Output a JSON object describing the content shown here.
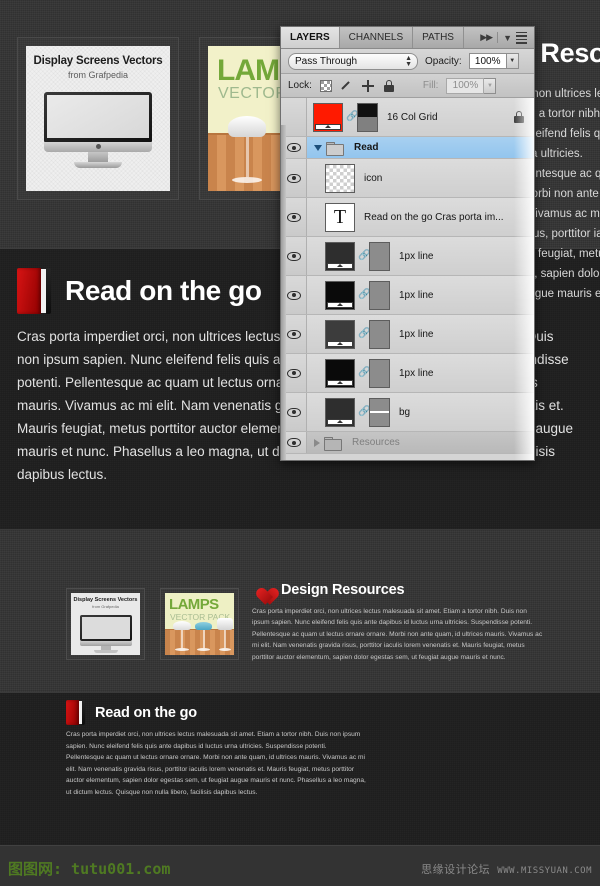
{
  "hero": {
    "thumb_display": {
      "title": "Display Screens Vectors",
      "subtitle": "from Grafpedia"
    },
    "thumb_lamps": {
      "line1": "LAMPS",
      "line2": "VECTOR PACK"
    },
    "resources_title": "Design Resources",
    "resources_body": "Cras porta imperdiet orci, non ultrices lectus malesuada sit amet. Etiam a tortor nibh. Duis non ipsum sapien. Nunc eleifend felis quis ante dapibus id luctus urna ultricies. Suspendisse potenti. Pellentesque ac quam ut lectus ornare ornare. Morbi non ante quam, id ultrices mauris. Vivamus ac mi elit. Nam venenatis gravida risus, porttitor iaculis lorem venenatis et. Mauris feugiat, metus porttitor auctor elementum, sapien dolor egestas sem, ut feugiat augue mauris et nunc."
  },
  "read_section": {
    "title": "Read on the go",
    "body": "Cras porta imperdiet orci, non ultrices lectus malesuada sit amet. Etiam a tortor nibh. Duis non ipsum sapien. Nunc eleifend felis quis ante dapibus id luctus urna ultricies. Suspendisse potenti. Pellentesque ac quam ut lectus ornare ornare. Morbi non ante quam, id ultrices mauris. Vivamus ac mi elit. Nam venenatis gravida risus, porttitor iaculis lorem venenatis et. Mauris feugiat, metus porttitor auctor elementum, sapien dolor egestas sem, ut feugiat augue mauris et nunc. Phasellus a leo magna, ut dictum lectus. Quisque non nulla libero, facilisis dapibus lectus."
  },
  "resources_section": {
    "title": "Design Resources",
    "body": "Cras porta imperdiet orci, non ultrices lectus malesuada sit amet. Etiam a tortor nibh. Duis non ipsum sapien. Nunc eleifend felis quis ante dapibus id luctus urna ultricies. Suspendisse potenti. Pellentesque ac quam ut lectus ornare ornare. Morbi non ante quam, id ultrices mauris. Vivamus ac mi elit. Nam venenatis gravida risus, porttitor iaculis lorem venenatis et. Mauris feugiat, metus porttitor auctor elementum, sapien dolor egestas sem, ut feugiat augue mauris et nunc.",
    "thumb_display": {
      "title": "Display Screens Vectors",
      "subtitle": "from Grafpedia"
    },
    "thumb_lamps": {
      "line1": "LAMPS",
      "line2": "VECTOR PACK"
    }
  },
  "read_section2": {
    "title": "Read on the go",
    "body": "Cras porta imperdiet orci, non ultrices lectus malesuada sit amet. Etiam a tortor nibh. Duis non ipsum sapien. Nunc eleifend felis quis ante dapibus id luctus urna ultricies. Suspendisse potenti. Pellentesque ac quam ut lectus ornare ornare. Morbi non ante quam, id ultrices mauris. Vivamus ac mi elit. Nam venenatis gravida risus, porttitor iaculis lorem venenatis et. Mauris feugiat, metus porttitor auctor elementum, sapien dolor egestas sem, ut feugiat augue mauris et nunc. Phasellus a leo magna, ut dictum lectus. Quisque non nulla libero, facilisis dapibus lectus."
  },
  "footer": {
    "watermark_left": "图图网: tutu001.com",
    "watermark_right_cn": "思缘设计论坛",
    "watermark_right_url": "WWW.MISSYUAN.COM"
  },
  "photoshop_panel": {
    "tabs": [
      {
        "label": "LAYERS",
        "active": true
      },
      {
        "label": "CHANNELS",
        "active": false
      },
      {
        "label": "PATHS",
        "active": false
      }
    ],
    "blend_mode": "Pass Through",
    "opacity_label": "Opacity:",
    "opacity_value": "100%",
    "lock_label": "Lock:",
    "fill_label": "Fill:",
    "fill_value": "100%",
    "lock_icons": [
      "transparency-checker-icon",
      "brush-icon",
      "move-icon",
      "lock-all-icon"
    ],
    "layers": [
      {
        "name": "16 Col Grid",
        "kind": "shape-mask",
        "visible": false,
        "locked": true,
        "selected": false,
        "thumb": "red"
      },
      {
        "name": "Read",
        "kind": "group",
        "visible": true,
        "locked": false,
        "selected": true,
        "expanded": true
      },
      {
        "name": "icon",
        "kind": "pixel",
        "visible": true,
        "locked": false,
        "selected": false,
        "thumb": "checker"
      },
      {
        "name": "Read on the go  Cras porta im...",
        "kind": "text",
        "visible": true,
        "locked": false,
        "selected": false,
        "thumb": "T"
      },
      {
        "name": "1px line",
        "kind": "shape-mask",
        "visible": true,
        "locked": false,
        "selected": false,
        "thumb": "dark"
      },
      {
        "name": "1px line",
        "kind": "shape-mask",
        "visible": true,
        "locked": false,
        "selected": false,
        "thumb": "black"
      },
      {
        "name": "1px line",
        "kind": "shape-mask",
        "visible": true,
        "locked": false,
        "selected": false,
        "thumb": "mid"
      },
      {
        "name": "1px line",
        "kind": "shape-mask",
        "visible": true,
        "locked": false,
        "selected": false,
        "thumb": "black"
      },
      {
        "name": "bg",
        "kind": "shape-mask",
        "visible": true,
        "locked": false,
        "selected": false,
        "thumb": "dark"
      },
      {
        "name": "Resources",
        "kind": "group",
        "visible": true,
        "locked": false,
        "selected": false,
        "expanded": false
      }
    ]
  },
  "colors": {
    "accent_red": "#d81414",
    "selection_blue": "#93c5ee",
    "panel_gray": "#d4d4d4",
    "page_dark": "#1e1e1e",
    "page_texture": "#333333",
    "watermark_green": "#4f7a22"
  }
}
